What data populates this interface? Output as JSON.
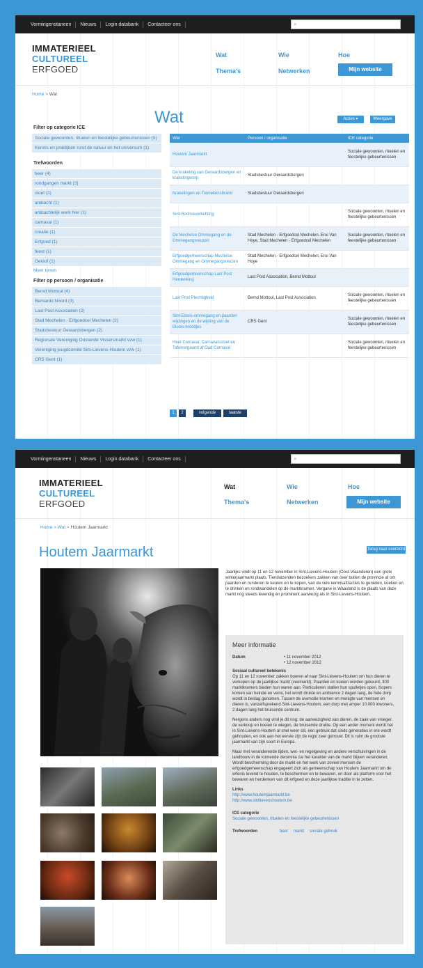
{
  "top_nav": [
    "Vormingenstaneen",
    "Nieuws",
    "Login databank",
    "Contacteer ons"
  ],
  "logo": {
    "line1": "IMMATERIEEL",
    "line2": "CULTUREEL",
    "line3": "ERFGOED"
  },
  "main_nav": {
    "wat": "Wat",
    "wie": "Wie",
    "hoe": "Hoe",
    "themas": "Thema's",
    "netwerken": "Netwerken",
    "mijn": "Mijn website"
  },
  "page1": {
    "breadcrumb": {
      "home": "Home",
      "sep": " > ",
      "current": "Wat"
    },
    "title": "Wat",
    "btn_a": "Acties ▾",
    "btn_b": "Weergave",
    "filter_category": {
      "heading": "Filter op categorie ICE",
      "items": [
        "Sociale gewoonten, rituelen en feestelijke gebeurtenissen (5)",
        "Kennis en praktijken rond de natuur en het universum (1)"
      ]
    },
    "filter_tags": {
      "heading": "Trefwoorden",
      "items": [
        "beer (4)",
        "rondgangen markt (3)",
        "stoet (3)",
        "ambacht (1)",
        "ambachtelijk werk hier (1)",
        "carnaval (1)",
        "creatie (1)",
        "Erfgoed (1)",
        "feest (1)",
        "Geloof (1)"
      ],
      "more": "Meer tonen"
    },
    "filter_people": {
      "heading": "Filter op persoon / organisatie",
      "items": [
        "Bernd Mottoul (4)",
        "Bernardo Noord (3)",
        "Last Post Association (2)",
        "Stad Mechelen - Erfgoedcel Mechelen (2)",
        "Stadsbestuur Geraardsbergen (2)",
        "Regionale Vereniging Oostende Vissersmarkt vzw (1)",
        "Vereniging jeugdcomité Sint-Lievens-Houtem vzw (1)",
        "CRS Gent (1)"
      ]
    },
    "table": {
      "headers": [
        "Wat",
        "Persoon / organisatie",
        "ICE categorie"
      ],
      "rows": [
        [
          "Houtem Jaarmarkt",
          "",
          "Sociale gewoonten, rituelen en feestelijke gebeurtenissen"
        ],
        [
          "De krakeling van Geraardsbergen en krakelingworp",
          "Stadsbestuur Geraardsbergen",
          ""
        ],
        [
          "Krakelingen en Tonnekensbrand",
          "Stadsbestuur Geraardsbergen",
          ""
        ],
        [
          "Sint-Rochusverlichting",
          "",
          "Sociale gewoonten, rituelen en feestelijke gebeurtenissen"
        ],
        [
          "De Mechelse Ommegang en de Ommegangsreuzen",
          "Stad Mechelen - Erfgoedcel Mechelen, Erui Van Hoye, Stad Mechelen - Erfgoedcel Mechelen",
          "Sociale gewoonten, rituelen en feestelijke gebeurtenissen"
        ],
        [
          "Erfgoedgemeenschap Mechelse Ommegang en Ommegangsreuzen",
          "Stad Mechelen - Erfgoedcel Mechelen, Erui Van Hoye",
          ""
        ],
        [
          "Erfgoedgemeenschap Last Post Herdenking",
          "Last Post Association, Bernd Mottoul",
          ""
        ],
        [
          "Last Post Plechtigheid",
          "Bernd Mottoul, Last Post Association",
          "Sociale gewoonten, rituelen en feestelijke gebeurtenissen"
        ],
        [
          "Sint-Eloois-ommegang en paarden wijdingen en de wijding van de Eloois-broodjes",
          "CRS Gent",
          "Sociale gewoonten, rituelen en feestelijke gebeurtenissen"
        ],
        [
          "Heet Carnaval, Carnavalsstoet en Tafelvergaand af Oud Carnaval",
          "",
          "Sociale gewoonten, rituelen en feestelijke gebeurtenissen"
        ]
      ]
    },
    "pager": {
      "p1": "1",
      "p2": "2",
      "next": "volgende",
      "last": "laatste"
    }
  },
  "page2": {
    "breadcrumb": {
      "home": "Home",
      "wat": "Wat",
      "sep": " > ",
      "current": "Houtem Jaarmarkt"
    },
    "title": "Houtem Jaarmarkt",
    "btn_back": "Terug naar overzicht",
    "intro": "Jaarlijks vindt op 11 en 12 november in Sint-Lievens-Houtem (Oost-Vlaanderen) een grote winterjaarmarkt plaats. Tienduizenden bezoekers zakken van over buiten de provincie af om paarden en runderen te keuren en te kopen, van de vele kermisattracties te genieten, koeken en te drinken en rondwandelen op de marktkramen. Vergane in Waasland is de plaats van deze markt nog steeds levendig en prominent aanwezig als in Sint-Lievens-Houtem.",
    "info": {
      "heading": "Meer informatie",
      "datum_label": "Datum",
      "dates": [
        "11 november 2012",
        "12 november 2012"
      ],
      "section_title": "Sociaal cultureel betekenis",
      "p1": "Op 11 en 12 november zakken boeren af naar Sint-Lievens-Houtem om hun dieren te verkopen op de jaarlijkse markt (veemarkt). Paarden en koeien worden gekeurd, 300 marktkramers bieden hun waren aan. Particulieren stallen hun spulletjes open, Kopers komen van heinde en verre, het wordt drukte en ambiance 2 dagen lang, de hele dorp wordt in beslag genomen. Tussen de overvolle kramen en menigte van mensen en dieren is, vanzelfsprekend Sint-Lievens-Houtem, een dorp met amper 10.000 inwoners, 2 dagen lang het bruisende centrum.",
      "p2": "Nergens anders nog vind je dit nog: de aanwezigheid van dieren, de zaak van vroeger, de verkoop en koeien te wiegen, de bruisende drukte. Op een ander moment wordt het in Sint-Lievens-Houtem al snel weer stil, een gebruik dat sinds generaties in ere wordt gehouden, en ook aan het eerste zijn de regio zeer getrouw. Dit is ruim de grootste jaarmarkt van zijn soort in Europa.",
      "p3": "Maar met veranderende tijden, wet- en regelgeving en andere verschuivingen in de landbouw in de komende decennia zal het karakter van de markt blijven veranderen. Wordt bescherming door de markt en het werk van zoveel mensen de erfgoedgemeenschap engageert zich als gemeenschap van Houtem Jaarmarkt om de erfenis levend te houden, te beschermen en te bewaren, en door als platform voor het bewaren en herdenken van dit erfgoed en deze jaarlijkse traditie in te zetten.",
      "links_label": "Links",
      "links": [
        "http://www.houtemjaarmarkt.be",
        "http://www.sintlievenshoutem.be"
      ],
      "ice_label": "ICE categorie",
      "ice_value": "Sociale gewoonten, rituelen en feestelijke gebeurtenissen",
      "tags_label": "Trefwoorden",
      "tags": [
        "beer",
        "markt",
        "sociale gebruik"
      ]
    }
  },
  "colors": {
    "accent": "#3d97d4",
    "border": "#3d97d4",
    "topbar": "#1f1f22",
    "sidebar_item": "#dceaf6",
    "info_box": "#e7e7e7"
  }
}
